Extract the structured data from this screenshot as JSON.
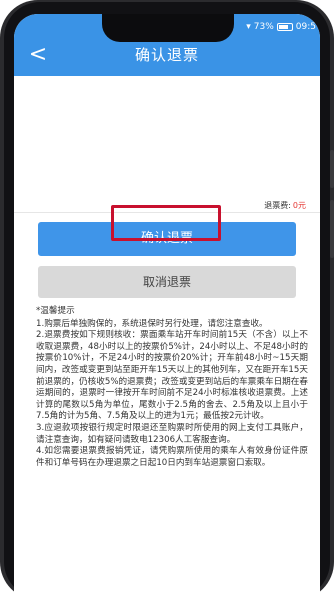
{
  "status_bar": {
    "battery_percent": "73%",
    "time": "09:5"
  },
  "header": {
    "back_glyph": "<",
    "title": "确认退票"
  },
  "refund": {
    "fee_label": "退票费:",
    "fee_value": "0元"
  },
  "buttons": {
    "confirm_label": "确认退票",
    "cancel_label": "取消退票"
  },
  "tips": {
    "title": "*温馨提示",
    "items": [
      "1.购票后单独购保的，系统退保时另行处理，请您注意查收。",
      "2.退票费按如下规则核收：票面乘车站开车时间前15天（不含）以上不收取退票费，48小时以上的按票价5%计，24小时以上、不足48小时的按票价10%计，不足24小时的按票价20%计；开车前48小时~15天期间内，改签或变更到站至距开车15天以上的其他列车，又在距开车15天前退票的，仍核收5%的退票费；改签或变更到站后的车票乘车日期在春运期间的，退票时一律按开车时间前不足24小时标准核收退票费。上述计算的尾数以5角为单位，尾数小于2.5角的舍去、2.5角及以上且小于7.5角的计为5角、7.5角及以上的进为1元；最低按2元计收。",
      "3.应退款项按银行规定时限退还至购票时所使用的网上支付工具账户，请注意查询，如有疑问请致电12306人工客服查询。",
      "4.如您需要退票费报销凭证，请凭购票所使用的乘车人有效身份证件原件和订单号码在办理退票之日起10日内到车站退票窗口索取。"
    ]
  },
  "colors": {
    "header_blue": "#3a93e6",
    "confirm_blue": "#3f95e9",
    "highlight_red": "#c8102e",
    "fee_red": "#e53935"
  }
}
